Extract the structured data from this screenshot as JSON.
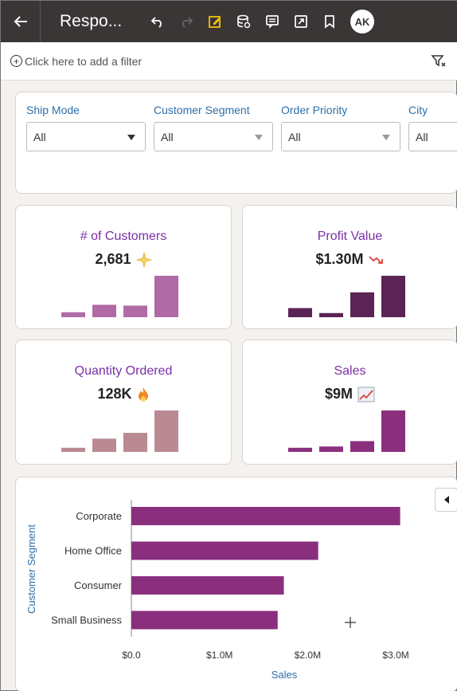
{
  "toolbar": {
    "title": "Respo...",
    "icons": [
      "back-arrow-icon",
      "undo-icon",
      "redo-icon",
      "edit-icon",
      "data-icon",
      "comment-icon",
      "present-icon",
      "bookmark-icon"
    ],
    "avatar_initials": "AK",
    "background": "#3b3636",
    "edit_icon_color": "#f5c200"
  },
  "filterbar": {
    "add_filter_text": "Click here to add a filter"
  },
  "selectors": [
    {
      "label": "Ship Mode",
      "value": "All"
    },
    {
      "label": "Customer Segment",
      "value": "All"
    },
    {
      "label": "Order Priority",
      "value": "All"
    },
    {
      "label": "City",
      "value": "All"
    }
  ],
  "tiles": [
    {
      "title": "# of Customers",
      "value": "2,681",
      "icon": "sparkle-icon",
      "bars": [
        0.12,
        0.3,
        0.28,
        1.0
      ],
      "color": "#b06aa6"
    },
    {
      "title": "Profit Value",
      "value": "$1.30M",
      "icon": "trend-down-icon",
      "bars": [
        0.22,
        0.1,
        0.6,
        1.0
      ],
      "color": "#5a2455"
    },
    {
      "title": "Quantity Ordered",
      "value": "128K",
      "icon": "flame-icon",
      "bars": [
        0.1,
        0.32,
        0.46,
        1.0
      ],
      "color": "#b98a92"
    },
    {
      "title": "Sales",
      "value": "$9M",
      "icon": "chart-up-icon",
      "bars": [
        0.1,
        0.13,
        0.26,
        1.0
      ],
      "color": "#8a2f7d"
    }
  ],
  "chart_data": {
    "type": "bar",
    "orientation": "horizontal",
    "categories": [
      "Corporate",
      "Home Office",
      "Consumer",
      "Small Business"
    ],
    "values": [
      3.05,
      2.12,
      1.73,
      1.66
    ],
    "value_unit": "$M",
    "ylabel": "Customer Segment",
    "xlabel": "Sales",
    "xticks": [
      "$0.0",
      "$1.0M",
      "$2.0M",
      "$3.0M"
    ],
    "xlim": [
      0,
      3.3
    ],
    "color": "#8a2f7d",
    "grid": false
  }
}
